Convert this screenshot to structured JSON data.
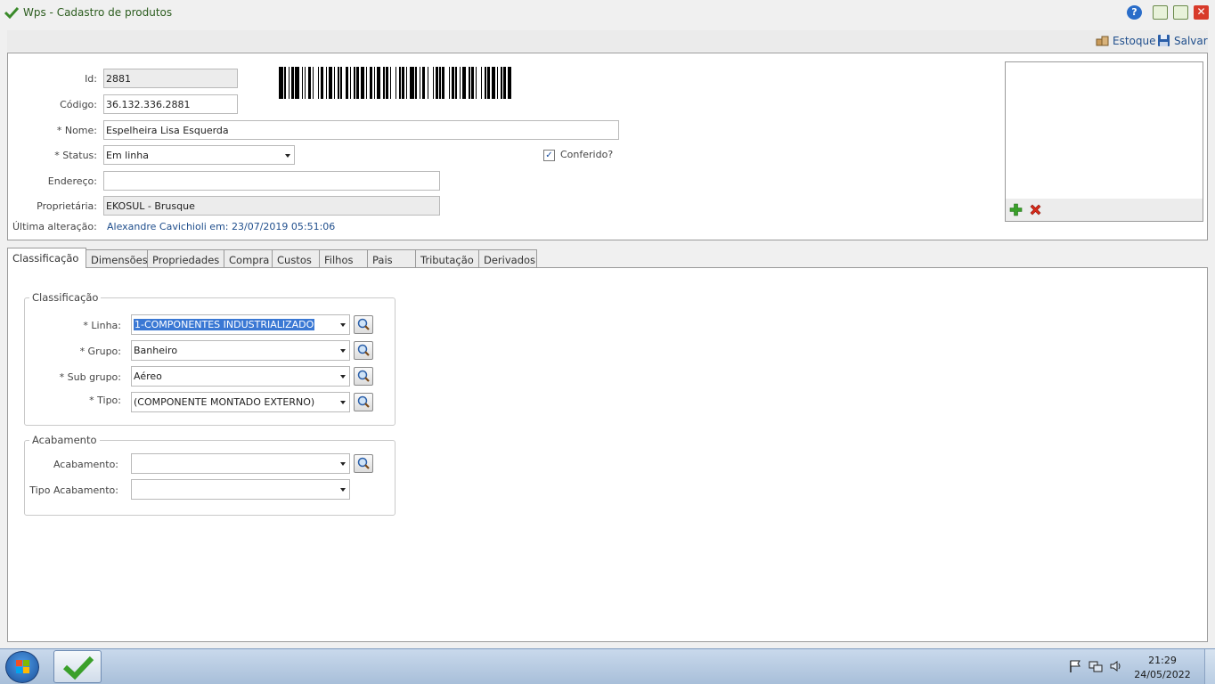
{
  "window": {
    "title": "Wps - Cadastro de produtos",
    "help_label": "?",
    "close_label": "✕"
  },
  "toolbar": {
    "estoque_label": "Estoque",
    "salvar_label": "Salvar"
  },
  "form": {
    "id_label": "Id:",
    "id_value": "2881",
    "codigo_label": "Código:",
    "codigo_value": "36.132.336.2881",
    "nome_label": "* Nome:",
    "nome_value": "Espelheira Lisa Esquerda",
    "status_label": "* Status:",
    "status_value": "Em linha",
    "endereco_label": "Endereço:",
    "endereco_value": "",
    "proprietaria_label": "Proprietária:",
    "proprietaria_value": "EKOSUL - Brusque",
    "conferido_label": "Conferido?",
    "conferido_checked": true,
    "ultima_alteracao_label": "Última alteração:",
    "ultima_alteracao_value": "Alexandre Cavichioli em: 23/07/2019 05:51:06"
  },
  "tabs": [
    {
      "label": "Classificação",
      "active": true
    },
    {
      "label": "Dimensões"
    },
    {
      "label": "Propriedades"
    },
    {
      "label": "Compra"
    },
    {
      "label": "Custos"
    },
    {
      "label": "Filhos"
    },
    {
      "label": "Pais"
    },
    {
      "label": "Tributação"
    },
    {
      "label": "Derivados"
    }
  ],
  "classificacao": {
    "group_title": "Classificação",
    "linha_label": "* Linha:",
    "linha_value": "1-COMPONENTES INDUSTRIALIZADO",
    "grupo_label": "* Grupo:",
    "grupo_value": "Banheiro",
    "subgrupo_label": "* Sub grupo:",
    "subgrupo_value": "Aéreo",
    "tipo_label": "* Tipo:",
    "tipo_value": "(COMPONENTE MONTADO EXTERNO)"
  },
  "acabamento": {
    "group_title": "Acabamento",
    "acabamento_label": "Acabamento:",
    "acabamento_value": "",
    "tipo_acabamento_label": "Tipo Acabamento:",
    "tipo_acabamento_value": ""
  },
  "taskbar": {
    "time": "21:29",
    "date": "24/05/2022"
  },
  "colors": {
    "accent": "#1f4e8c",
    "title_green": "#2b5c1e",
    "selection": "#3a78d4"
  }
}
